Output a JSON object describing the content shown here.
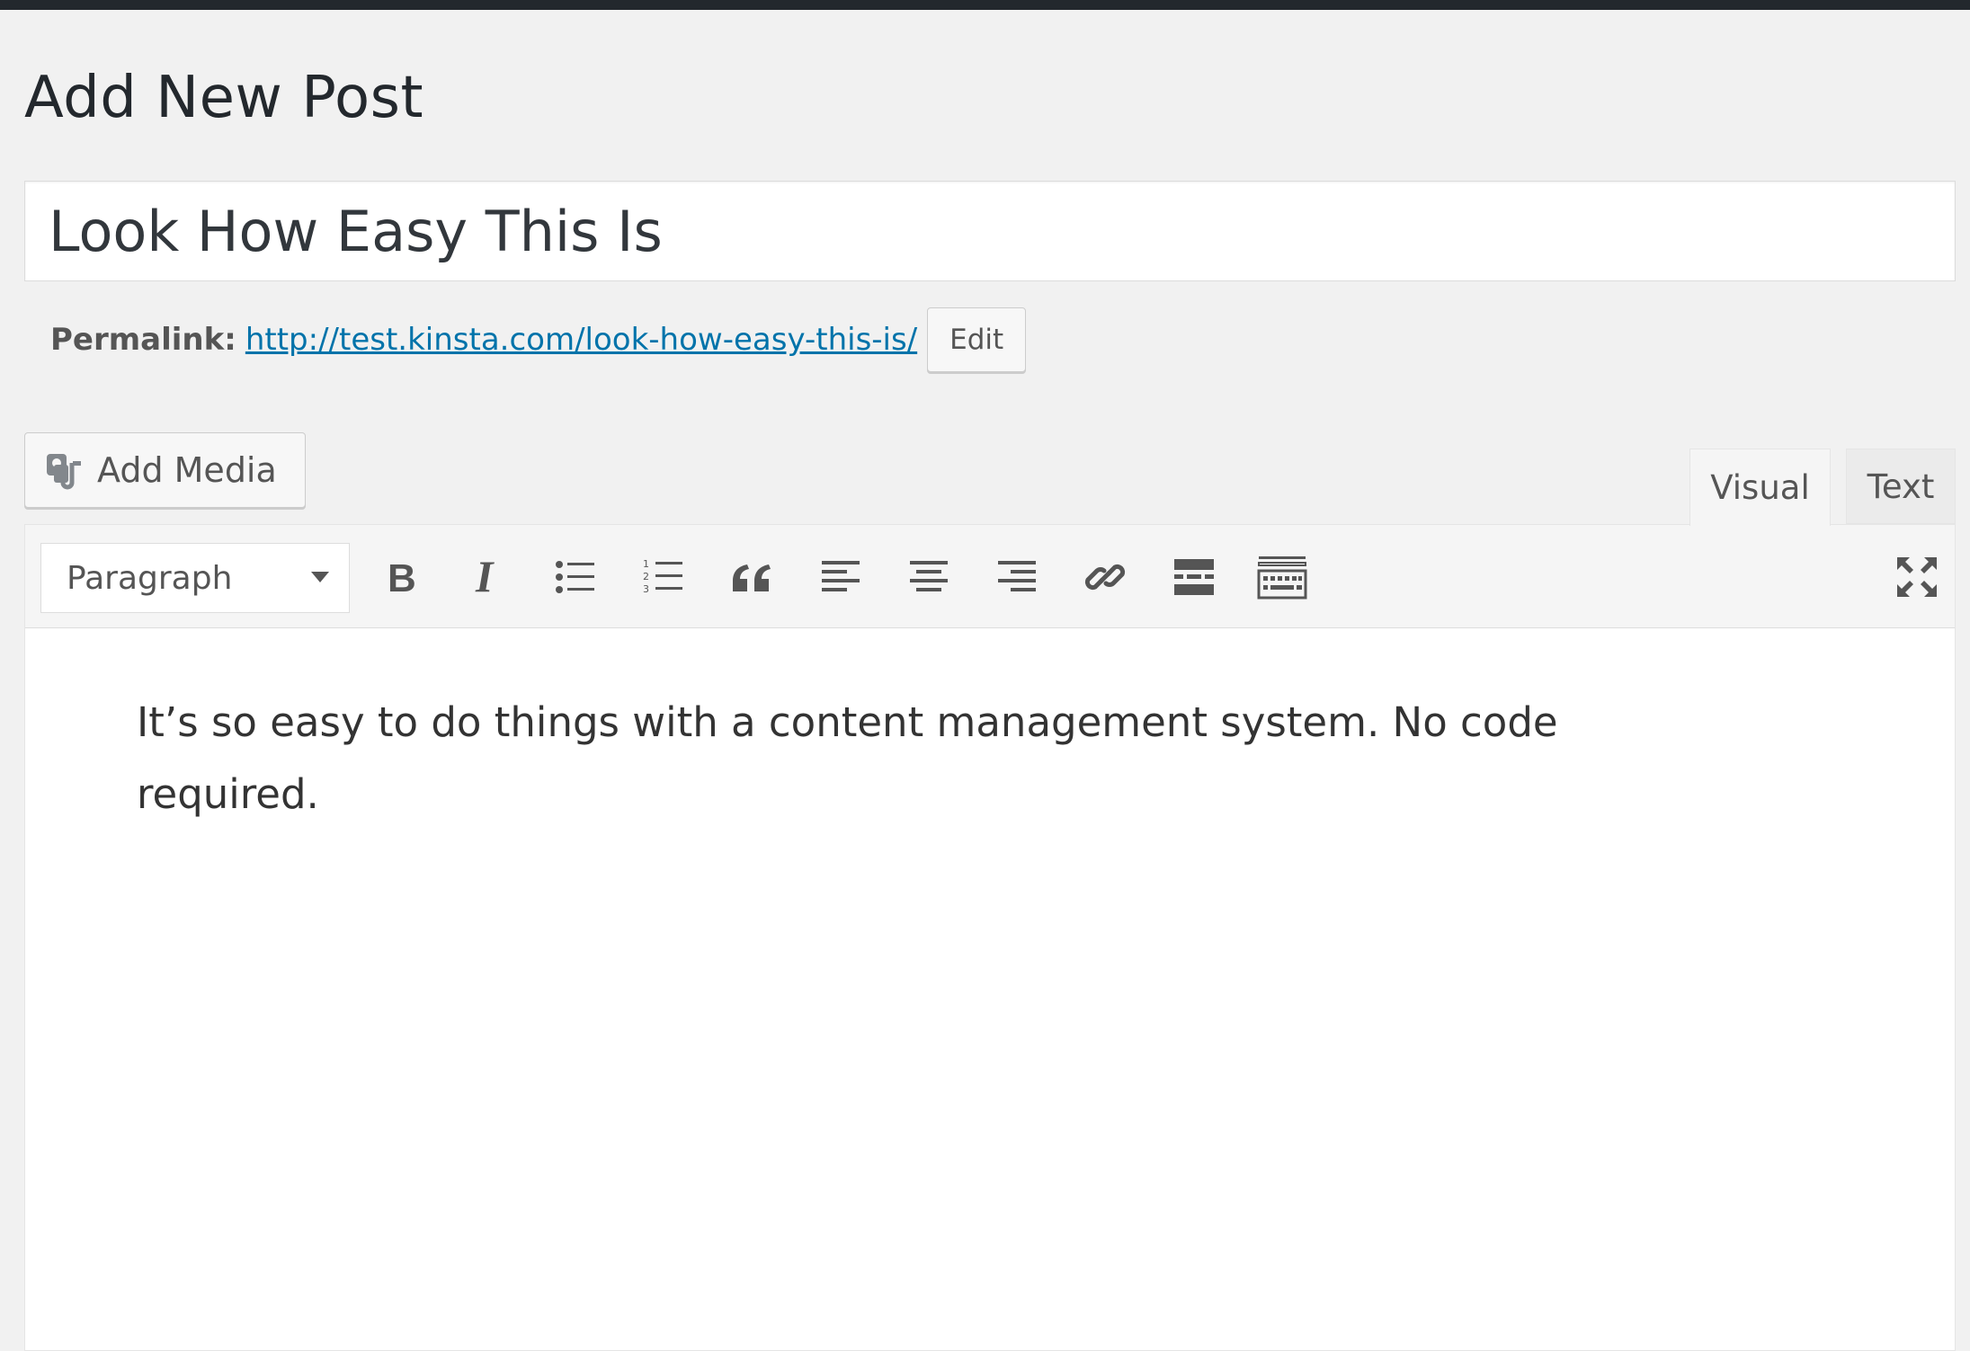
{
  "page": {
    "title": "Add New Post"
  },
  "post": {
    "title_value": "Look How Easy This Is",
    "permalink_label": "Permalink:",
    "permalink_url": "http://test.kinsta.com/look-how-easy-this-is/",
    "permalink_edit_label": "Edit"
  },
  "media": {
    "add_media_label": "Add Media",
    "icon": "add-media-icon"
  },
  "tabs": [
    {
      "label": "Visual",
      "active": true
    },
    {
      "label": "Text",
      "active": false
    }
  ],
  "toolbar": {
    "format_select_value": "Paragraph",
    "buttons": [
      {
        "name": "bold",
        "icon": "bold-icon"
      },
      {
        "name": "italic",
        "icon": "italic-icon"
      },
      {
        "name": "bulleted-list",
        "icon": "bulleted-list-icon"
      },
      {
        "name": "numbered-list",
        "icon": "numbered-list-icon"
      },
      {
        "name": "blockquote",
        "icon": "blockquote-icon"
      },
      {
        "name": "align-left",
        "icon": "align-left-icon"
      },
      {
        "name": "align-center",
        "icon": "align-center-icon"
      },
      {
        "name": "align-right",
        "icon": "align-right-icon"
      },
      {
        "name": "insert-link",
        "icon": "link-icon"
      },
      {
        "name": "read-more",
        "icon": "read-more-icon"
      },
      {
        "name": "toolbar-toggle",
        "icon": "keyboard-icon"
      },
      {
        "name": "fullscreen",
        "icon": "fullscreen-icon"
      }
    ]
  },
  "editor": {
    "content": "It’s so easy to do things with a content management system. No code required."
  },
  "colors": {
    "link": "#0073aa",
    "admin_bar": "#23282d",
    "background": "#f1f1f1"
  }
}
